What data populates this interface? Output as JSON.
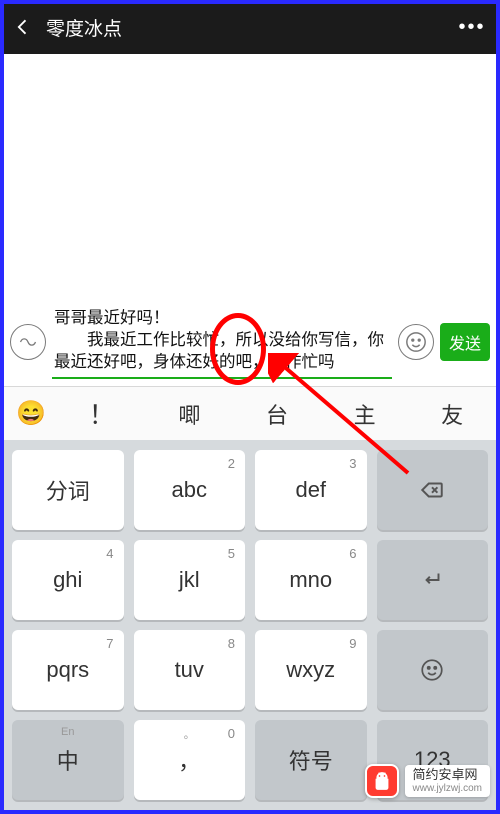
{
  "header": {
    "title": "零度冰点"
  },
  "input": {
    "line1": "哥哥最近好吗！",
    "line2": "我最近工作比较忙，所以没给你写信，你最近还好吧，身体还好的吧，工作忙吗",
    "send_label": "发送"
  },
  "candidates": {
    "emoji": "😄",
    "items": [
      "！",
      "唧",
      "台",
      "主",
      "友"
    ]
  },
  "keyboard": {
    "r1c1": "分词",
    "r1c2": "abc",
    "r1c3": "def",
    "r2c1": "ghi",
    "r2c2": "jkl",
    "r2c3": "mno",
    "r3c1": "pqrs",
    "r3c2": "tuv",
    "r3c3": "wxyz",
    "r4c1_top": "En",
    "r4c1": "中",
    "r4c2_top": "。",
    "r4c2": "，",
    "r4c3": "符号",
    "r4c4": "123",
    "n2": "2",
    "n3": "3",
    "n4": "4",
    "n5": "5",
    "n6": "6",
    "n7": "7",
    "n8": "8",
    "n9": "9",
    "n0": "0"
  },
  "watermark": {
    "cn": "简约安卓网",
    "url": "www.jylzwj.com"
  },
  "colors": {
    "accent": "#1aad19",
    "annotation": "#ff0000",
    "frame": "#2a2aff"
  }
}
